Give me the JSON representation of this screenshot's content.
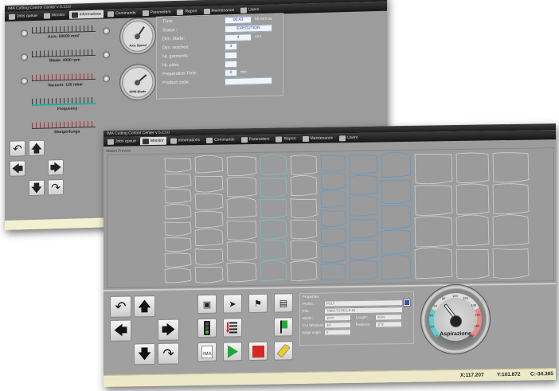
{
  "back_window": {
    "title": "IMA Cutting Control Center v 5.13.0",
    "menu": [
      {
        "label": "Jobs queue",
        "icon": "list-icon"
      },
      {
        "label": "Monitor",
        "icon": "monitor-icon"
      },
      {
        "label": "Informations",
        "icon": "info-icon"
      },
      {
        "label": "Commands",
        "icon": "hand-icon"
      },
      {
        "label": "Parameters",
        "icon": "gears-icon"
      },
      {
        "label": "Report",
        "icon": "chart-icon"
      },
      {
        "label": "Maintenance",
        "icon": "wrench-icon"
      },
      {
        "label": "Users",
        "icon": "users-icon"
      }
    ],
    "selected_menu": 2,
    "gauges": [
      {
        "label": "Axis: 50000 mm/'",
        "color": "dark",
        "value": 0.42
      },
      {
        "label": "Blade: 4000 rpm",
        "color": "dark",
        "value": 0.5
      },
      {
        "label": "Vacuum: 120 mbar",
        "color": "red",
        "value": 0.45
      },
      {
        "label": "Frequency",
        "color": "teal",
        "value": 0.5
      },
      {
        "label": "Shotperlunga",
        "color": "red",
        "value": 0.5
      }
    ],
    "dials": [
      {
        "label": "Axis Speed"
      },
      {
        "label": "RPM Blade"
      }
    ],
    "info": {
      "time_label": "Time:",
      "time_value": "00:43",
      "time_unit": "hh:mm:ss",
      "status_label": "Status :",
      "status_value": "EXECUTION",
      "dim_blade_label": "Dim. blade:",
      "dim_blade_value": "4",
      "dim_blade_unit": "mm",
      "dim_notches_label": "Dim. notches:",
      "dim_notches_value": "4",
      "garments_label": "Nr. garments:",
      "garments_value": "",
      "plies_label": "Nr. plies:",
      "plies_value": "",
      "prep_label": "Preparation Time:",
      "prep_value": "0",
      "prep_unit": "min",
      "product_label": "Product code:",
      "product_value": ""
    }
  },
  "front_window": {
    "title": "IMA Cutting Control Center v 5.13.0",
    "menu": [
      {
        "label": "Jobs queue",
        "icon": "list-icon"
      },
      {
        "label": "Monitor",
        "icon": "monitor-icon"
      },
      {
        "label": "Informations",
        "icon": "info-icon"
      },
      {
        "label": "Commands",
        "icon": "hand-icon"
      },
      {
        "label": "Parameters",
        "icon": "gears-icon"
      },
      {
        "label": "Report",
        "icon": "chart-icon"
      },
      {
        "label": "Maintenance",
        "icon": "wrench-icon"
      },
      {
        "label": "Users",
        "icon": "users-icon"
      }
    ],
    "selected_menu": 1,
    "section_label": "Station Preview",
    "properties": {
      "title": "Properties",
      "profile_label": "Profile:",
      "profile_value": "POLY",
      "file_label": "File:",
      "file_value": "TABO-TOTBCLP-60",
      "width_label": "Width:",
      "width_value": "1500",
      "length_label": "Length:",
      "length_value": "4544",
      "windows_label": "Cut Windows:",
      "windows_value": "1/4",
      "patterns_label": "Patterns:",
      "patterns_value": "1/72",
      "edge_label": "Edge angle:",
      "edge_value": "0"
    },
    "dial": {
      "label": "Aspirazione",
      "ticks": [
        "0",
        "20",
        "40",
        "60",
        "80",
        "100",
        "120",
        "140",
        "160",
        "180",
        "200"
      ],
      "value": 72
    },
    "status": {
      "x": "X:117.207",
      "y": "Y:101.872",
      "c": "C:-34.365"
    },
    "colors": {
      "accent_teal": "#3cc6c6",
      "highlight_blue": "#3e88c8",
      "play_green": "#22a83a",
      "stop_red": "#d22a22",
      "status_bar": "#ede9c8"
    }
  }
}
